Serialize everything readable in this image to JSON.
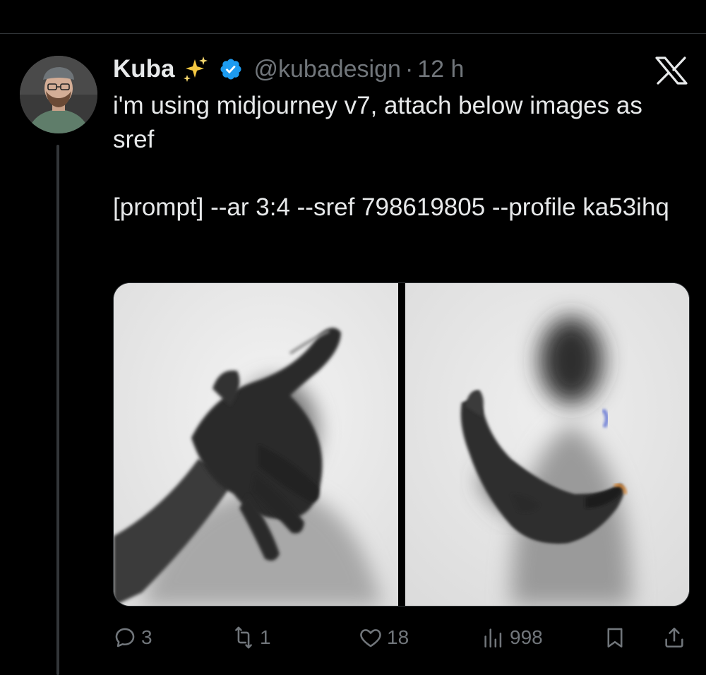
{
  "tweet": {
    "author": {
      "display_name": "Kuba",
      "handle": "@kubadesign",
      "verified": true,
      "badge_emoji": "sparkles-icon",
      "avatar": "avatar"
    },
    "separator": "·",
    "time": "12 h",
    "text_lines": [
      "i'm using midjourney v7, attach below images as sref",
      "[prompt] --ar 3:4 --sref 798619805 --profile ka53ihq"
    ],
    "media": [
      {
        "name": "reaching-hand-portrait"
      },
      {
        "name": "hand-behind-frosted-glass"
      }
    ],
    "actions": {
      "replies": "3",
      "reposts": "1",
      "likes": "18",
      "views": "998"
    }
  },
  "colors": {
    "background": "#000000",
    "text": "#e7e9ea",
    "muted": "#71767b",
    "verified_blue": "#1d9bf0",
    "divider": "#2f3336"
  }
}
